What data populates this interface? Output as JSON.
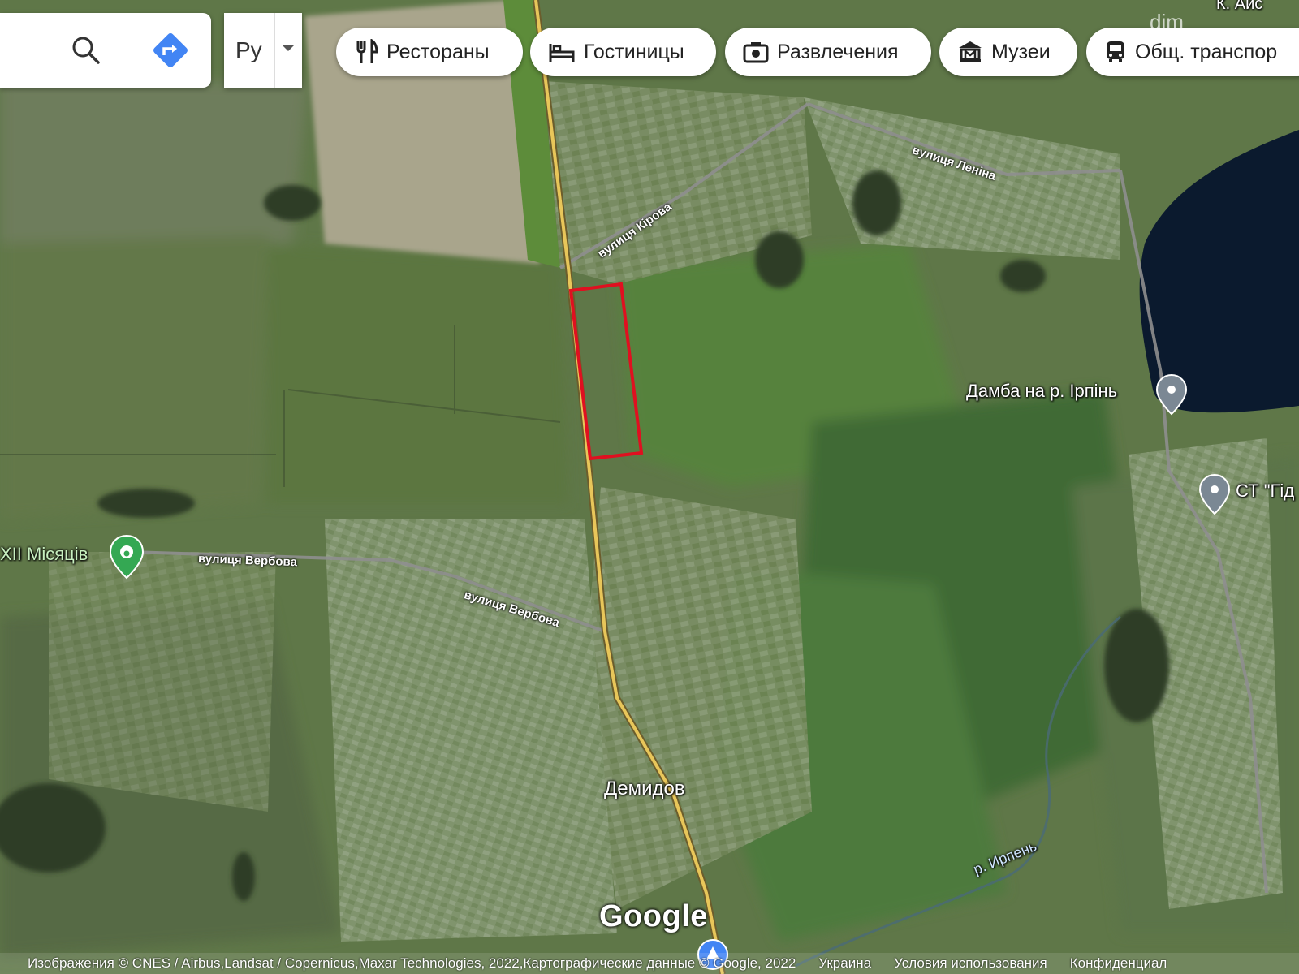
{
  "search_box": {
    "search_icon": "search-icon",
    "directions_icon": "directions-icon"
  },
  "language": {
    "value": "Ру"
  },
  "categories": [
    {
      "label": "Рестораны",
      "icon": "fork-knife-icon"
    },
    {
      "label": "Гостиницы",
      "icon": "bed-icon"
    },
    {
      "label": "Развлечения",
      "icon": "camera-icon"
    },
    {
      "label": "Музеи",
      "icon": "museum-icon"
    },
    {
      "label": "Общ. транспор",
      "icon": "bus-icon"
    }
  ],
  "watermark": {
    "text": "dim",
    "fragment": "К. Айс"
  },
  "roads": {
    "kirova": "вулиця Кірова",
    "lenina": "вулиця Леніна",
    "verbova_1": "вулиця Вербова",
    "verbova_2": "вулиця Вербова"
  },
  "places": {
    "dam": "Дамба на р. Ірпінь",
    "st": "СТ \"Гід",
    "misyatsiv": "XII Місяців",
    "demydiv": "Демидов",
    "river": "р. Ирпень"
  },
  "logo": "Google",
  "footer": {
    "imagery": "Изображения © CNES / Airbus,Landsat / Copernicus,Maxar Technologies, 2022,Картографические данные © Google, 2022",
    "country": "Украина",
    "terms": "Условия использования",
    "privacy": "Конфиденциал"
  },
  "colors": {
    "parcel_outline": "#e01020",
    "highway": "#e8c65a",
    "water": "#0b1a2e"
  }
}
